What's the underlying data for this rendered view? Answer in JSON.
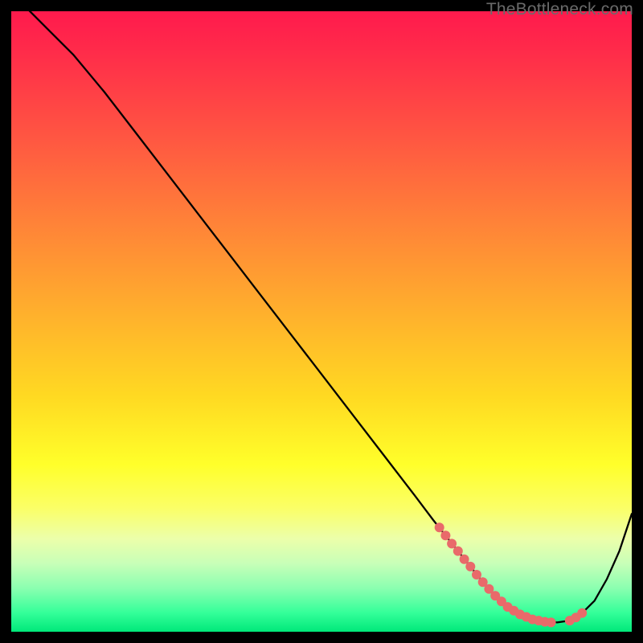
{
  "watermark": {
    "text": "TheBottleneck.com"
  },
  "colors": {
    "curve_stroke": "#000000",
    "marker_fill": "#e96a6a",
    "marker_stroke": "#e96a6a"
  },
  "chart_data": {
    "type": "line",
    "title": "",
    "xlabel": "",
    "ylabel": "",
    "xlim": [
      0,
      100
    ],
    "ylim": [
      0,
      100
    ],
    "grid": false,
    "series": [
      {
        "name": "bottleneck-curve",
        "x": [
          0,
          3,
          6,
          10,
          15,
          20,
          25,
          30,
          35,
          40,
          45,
          50,
          55,
          60,
          65,
          68,
          70,
          72,
          74,
          76,
          78,
          80,
          82,
          84,
          86,
          88,
          90,
          92,
          94,
          96,
          98,
          100
        ],
        "y": [
          103,
          100,
          97,
          93,
          87,
          80.5,
          74,
          67.5,
          61,
          54.5,
          48,
          41.5,
          35,
          28.5,
          22,
          18,
          15.5,
          13,
          10.5,
          8,
          5.8,
          4,
          2.8,
          2,
          1.6,
          1.5,
          1.8,
          3,
          5,
          8.5,
          13,
          19
        ]
      }
    ],
    "markers": {
      "name": "highlighted-points",
      "x": [
        69,
        70,
        71,
        72,
        73,
        74,
        75,
        76,
        77,
        78,
        79,
        80,
        81,
        82,
        83,
        84,
        85,
        86,
        87,
        90,
        91,
        92
      ],
      "y": [
        16.8,
        15.5,
        14.2,
        13,
        11.7,
        10.5,
        9.2,
        8,
        6.9,
        5.8,
        4.9,
        4,
        3.4,
        2.8,
        2.4,
        2,
        1.8,
        1.6,
        1.5,
        1.8,
        2.3,
        3
      ]
    }
  }
}
